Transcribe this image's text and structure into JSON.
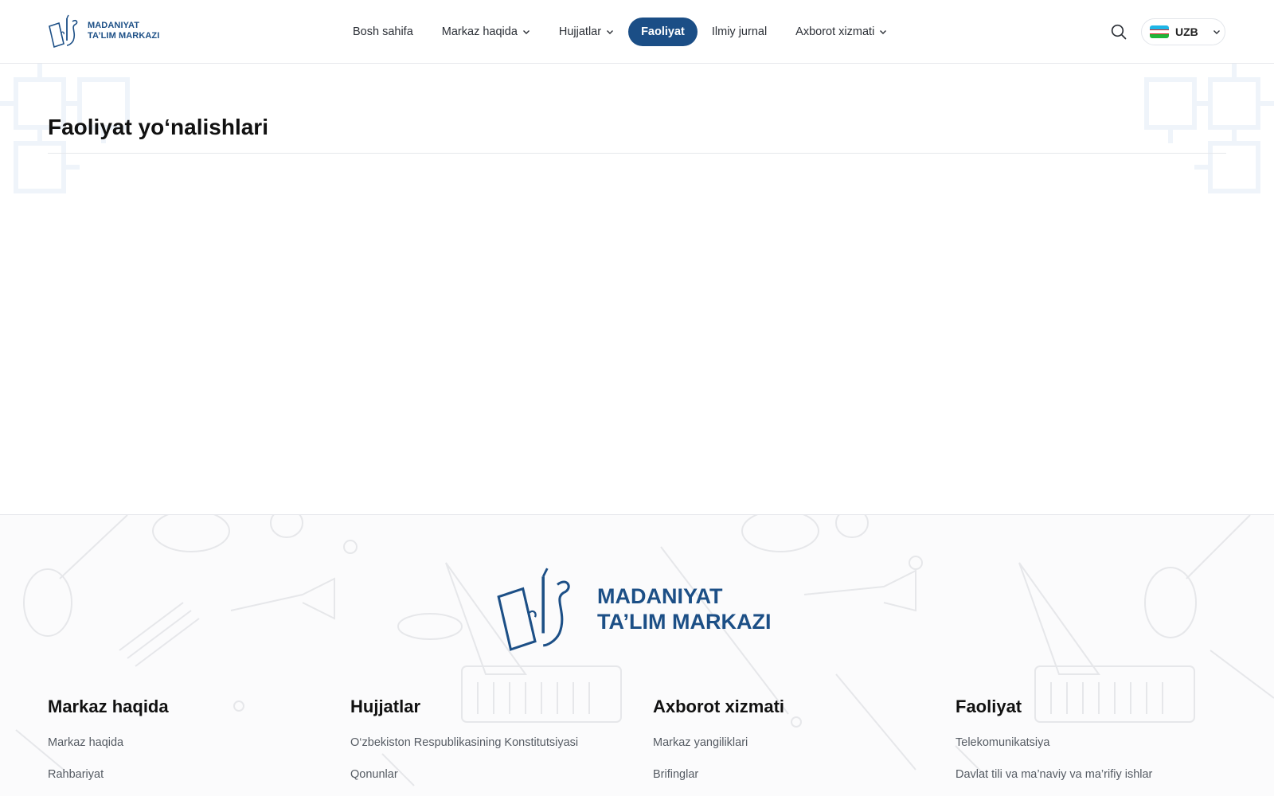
{
  "header": {
    "logo": {
      "line1": "MADANIYAT",
      "line2": "TA’LIM MARKAZI"
    },
    "nav": [
      {
        "label": "Bosh sahifa",
        "dropdown": false,
        "active": false
      },
      {
        "label": "Markaz haqida",
        "dropdown": true,
        "active": false
      },
      {
        "label": "Hujjatlar",
        "dropdown": true,
        "active": false
      },
      {
        "label": "Faoliyat",
        "dropdown": false,
        "active": true
      },
      {
        "label": "Ilmiy jurnal",
        "dropdown": false,
        "active": false
      },
      {
        "label": "Axborot xizmati",
        "dropdown": true,
        "active": false
      }
    ],
    "search_icon": "search-icon",
    "language": {
      "label": "UZB",
      "flag_colors": [
        "#1eb5e6",
        "#ffffff",
        "#1eb53a"
      ]
    }
  },
  "main": {
    "title": "Faoliyat yo‘nalishlari"
  },
  "footer": {
    "logo": {
      "line1": "MADANIYAT",
      "line2": "TA’LIM MARKAZI"
    },
    "columns": [
      {
        "title": "Markaz haqida",
        "links": [
          "Markaz haqida",
          "Rahbariyat"
        ]
      },
      {
        "title": "Hujjatlar",
        "links": [
          "O‘zbekiston Respublikasining Konstitutsiyasi",
          "Qonunlar"
        ]
      },
      {
        "title": "Axborot xizmati",
        "links": [
          "Markaz yangiliklari",
          "Brifinglar"
        ]
      },
      {
        "title": "Faoliyat",
        "links": [
          "Telekomunikatsiya",
          "Davlat tili va ma’naviy va ma’rifiy ishlar"
        ]
      }
    ]
  },
  "colors": {
    "brand": "#1b4e86",
    "text": "#111111",
    "muted": "#555b63",
    "border": "#e6e8ec"
  }
}
